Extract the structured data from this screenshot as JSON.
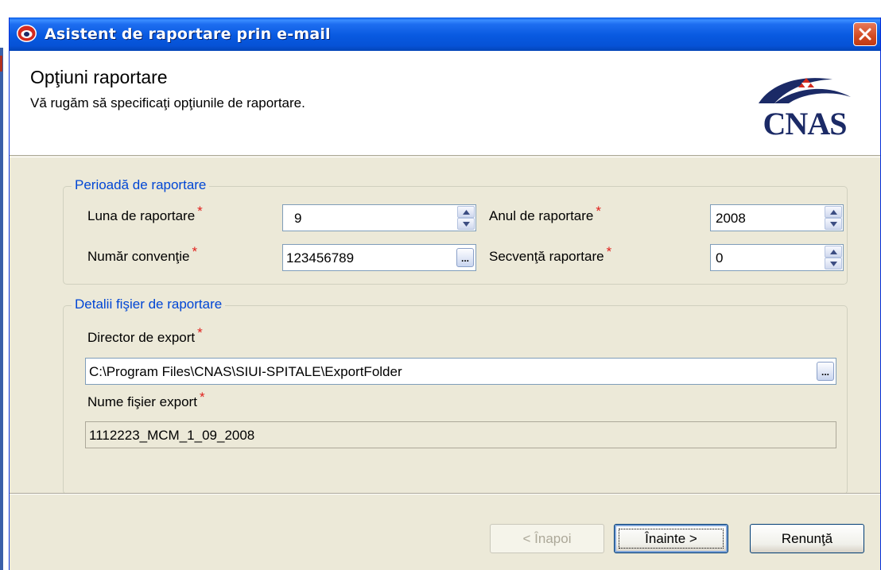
{
  "window": {
    "title": "Asistent de raportare prin e-mail"
  },
  "header": {
    "title": "Opţiuni raportare",
    "subtitle": "Vă rugăm să specificaţi opţiunile de raportare.",
    "logo_text": "CNAS"
  },
  "required_marker": "*",
  "period_group": {
    "legend": "Perioadă de raportare",
    "month_label": "Luna de raportare",
    "month_value": "9",
    "year_label": "Anul de raportare",
    "year_value": "2008",
    "convention_label": "Număr convenţie",
    "convention_value": "123456789",
    "sequence_label": "Secvenţă raportare",
    "sequence_value": "0"
  },
  "file_group": {
    "legend": "Detalii fişier de raportare",
    "export_dir_label": "Director de export",
    "export_dir_value": "C:\\Program Files\\CNAS\\SIUI-SPITALE\\ExportFolder",
    "export_name_label": "Nume fişier export",
    "export_name_value": "1112223_MCM_1_09_2008"
  },
  "browse_label": "...",
  "buttons": {
    "back": "< Înapoi",
    "next": "Înainte >",
    "cancel": "Renunţă"
  },
  "colors": {
    "titlebar": "#0859e0",
    "legend": "#0046d5",
    "required": "#e0201c",
    "dialog_bg": "#ece9d8",
    "logo": "#1b2a66"
  }
}
